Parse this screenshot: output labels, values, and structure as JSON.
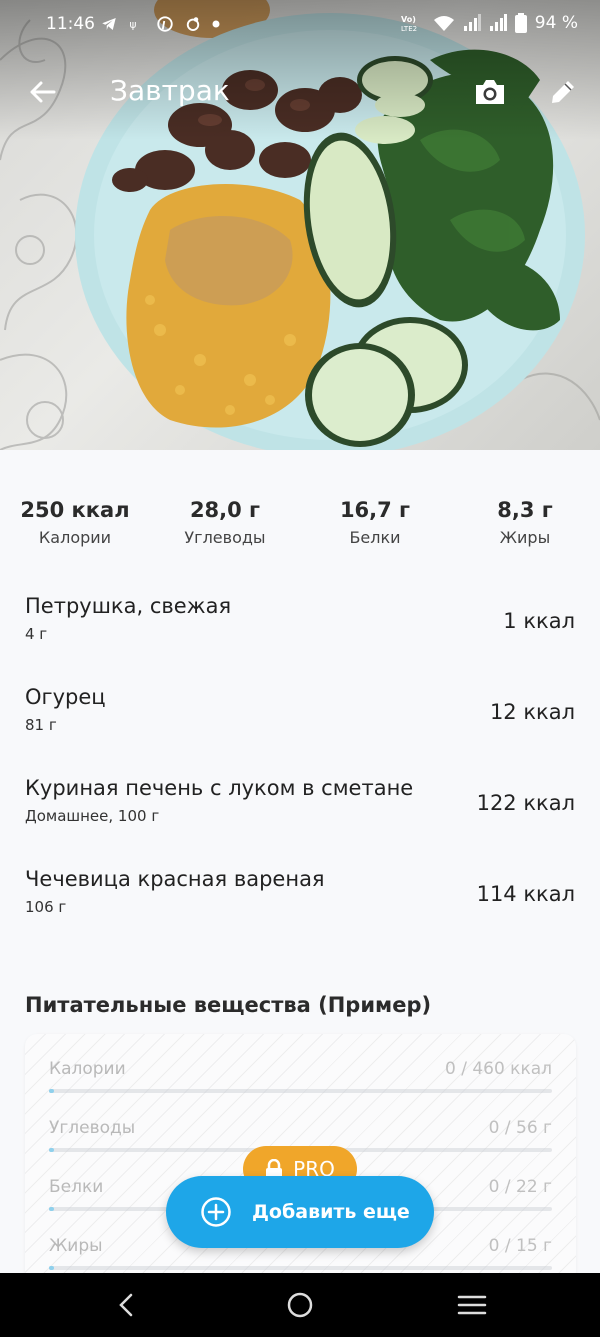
{
  "status_bar": {
    "time": "11:46",
    "battery": "94 %",
    "network_label": "Vo) LTE2"
  },
  "header": {
    "title": "Завтрак"
  },
  "macros": [
    {
      "value": "250 ккал",
      "label": "Калории"
    },
    {
      "value": "28,0 г",
      "label": "Углеводы"
    },
    {
      "value": "16,7 г",
      "label": "Белки"
    },
    {
      "value": "8,3 г",
      "label": "Жиры"
    }
  ],
  "foods": [
    {
      "name": "Петрушка, свежая",
      "detail": "4 г",
      "kcal": "1 ккал"
    },
    {
      "name": "Огурец",
      "detail": "81 г",
      "kcal": "12 ккал"
    },
    {
      "name": "Куриная печень с луком в сметане",
      "detail": "Домашнее, 100 г",
      "kcal": "122 ккал"
    },
    {
      "name": "Чечевица красная вареная",
      "detail": "106 г",
      "kcal": "114 ккал"
    }
  ],
  "nutrients": {
    "title": "Питательные вещества (Пример)",
    "rows": [
      {
        "name": "Калории",
        "value": "0 / 460 ккал",
        "progress": 0
      },
      {
        "name": "Углеводы",
        "value": "0 / 56 г",
        "progress": 0
      },
      {
        "name": "Белки",
        "value": "0 / 22 г",
        "progress": 0
      },
      {
        "name": "Жиры",
        "value": "0 / 15 г",
        "progress": 0
      }
    ]
  },
  "pro_badge": {
    "label": "PRO",
    "icon": "lock-icon"
  },
  "fab": {
    "label": "Добавить еще",
    "icon": "add-circle-icon"
  },
  "colors": {
    "accent": "#1ea6e8",
    "pro": "#f0a62a",
    "bar_fill": "#8fd0ec"
  }
}
